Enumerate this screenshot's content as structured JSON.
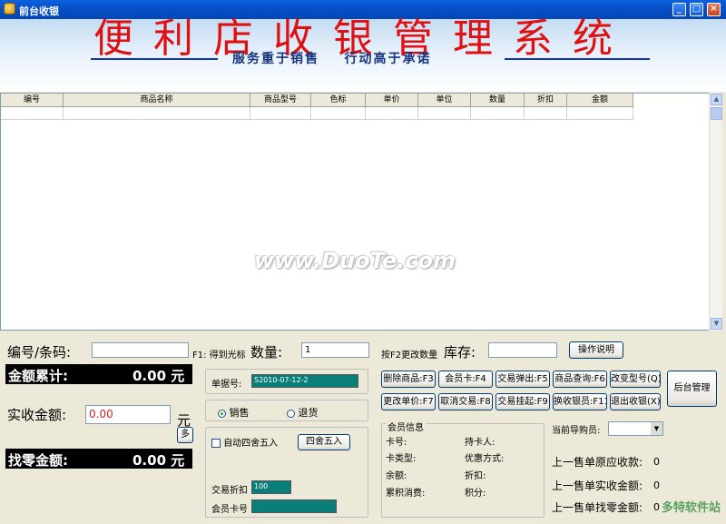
{
  "window": {
    "title": "前台收银"
  },
  "banner": {
    "title": "便利店收银管理系统",
    "slogan": "服务重于销售    行动高于承诺"
  },
  "grid": {
    "columns": [
      "编号",
      "商品名称",
      "商品型号",
      "色标",
      "单价",
      "单位",
      "数量",
      "折扣",
      "金额"
    ]
  },
  "watermark": "www.DuoTe.com",
  "form": {
    "code_label": "编号/条码:",
    "code_hint": "F1: 得到光标",
    "qty_label": "数量:",
    "qty_value": "1",
    "qty_hint": "按F2更改数量",
    "stock_label": "库存:",
    "total_label": "金额累计:",
    "total_value": "0.00 元",
    "received_label": "实收金额:",
    "received_value": "0.00",
    "received_unit": "元",
    "change_label": "找零金额:",
    "change_value": "0.00 元",
    "receipt_label": "单据号:",
    "receipt_value": "S2010-07-12-2",
    "sale_label": "销售",
    "return_label": "退货",
    "auto_round_label": "自动四舍五入",
    "trade_discount_label": "交易折扣",
    "trade_discount_value": "100",
    "member_card_label": "会员卡号",
    "current_guide_label": "当前导购员:"
  },
  "buttons": {
    "help": "操作说明",
    "more": "多",
    "round": "四舍五入",
    "delete_item": "删除商品:F3",
    "member_card": "会员卡:F4",
    "pop_trade": "交易弹出:F5",
    "item_query": "商品查询:F6",
    "change_model": "改变型号(Q)",
    "change_price": "更改单价:F7",
    "cancel_trade": "取消交易:F8",
    "hold_trade": "交易挂起:F9",
    "switch_cashier": "换收银员:F11",
    "exit_cashier": "退出收银(X)",
    "admin": "后台管理"
  },
  "member": {
    "title": "会员信息",
    "card_no": "卡号:",
    "holder": "持卡人:",
    "card_type": "卡类型:",
    "offer": "优惠方式:",
    "balance": "余额:",
    "discount": "折扣:",
    "cumulative": "累积消费:",
    "points": "积分:"
  },
  "last_sale": {
    "receivable_label": "上一售单原应收款:",
    "receivable_value": "0",
    "received_label": "上一售单实收金额:",
    "received_value": "0",
    "change_label": "上一售单找零金额:",
    "change_value": "0"
  },
  "corner_logo": "多特软件站"
}
